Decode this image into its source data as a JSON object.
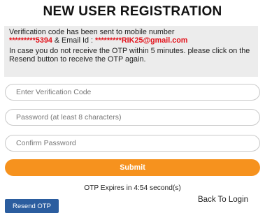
{
  "title": "NEW USER REGISTRATION",
  "notice": {
    "line1_pre": "Verification code has been sent to mobile number",
    "mobile": "*********5394",
    "email_label": " & Email Id : ",
    "email": "*********RIK25@gmail.com",
    "line2": "In case you do not receive the OTP within 5 minutes. please click on the Resend button to receive the OTP again."
  },
  "form": {
    "verification_placeholder": "Enter Verification Code",
    "password_placeholder": "Password (at least 8 characters)",
    "confirm_placeholder": "Confirm Password",
    "submit_label": "Submit"
  },
  "otp_expiry": "OTP Expires in 4:54 second(s)",
  "resend_label": "Resend OTP",
  "back_label": "Back To Login",
  "colors": {
    "accent_orange": "#f6921e",
    "highlight_red": "#e3121b",
    "resend_blue": "#2b5d9f",
    "notice_bg": "#ececec"
  }
}
